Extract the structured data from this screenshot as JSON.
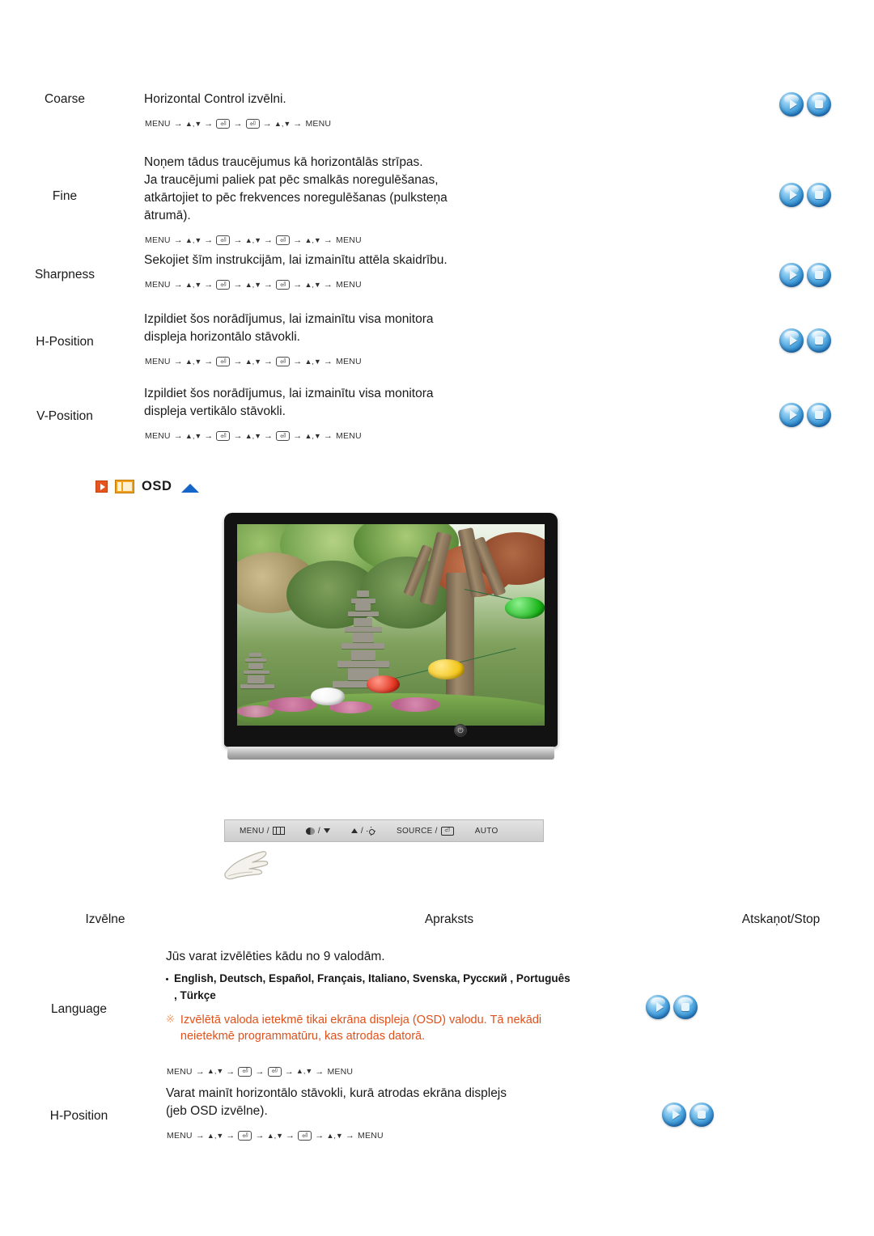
{
  "top_table": {
    "rows": [
      {
        "menu": "Coarse",
        "description": "Horizontal Control izvēlni.",
        "sequence_type": "short",
        "play_icon": "play-icon",
        "stop_icon": "stop-icon"
      },
      {
        "menu": "Fine",
        "description": "Noņem tādus traucējumus kā horizontālās strīpas.\nJa traucējumi paliek pat pēc smalkās noregulēšanas,\natkārtojiet to pēc frekvences noregulēšanas (pulksteņa\nātrumā).",
        "sequence_type": "long",
        "play_icon": "play-icon",
        "stop_icon": "stop-icon"
      },
      {
        "menu": "Sharpness",
        "description": "Sekojiet šīm instrukcijām, lai izmainītu attēla skaidrību.",
        "sequence_type": "long",
        "play_icon": "play-icon",
        "stop_icon": "stop-icon"
      },
      {
        "menu": "H-Position",
        "description": "Izpildiet šos norādījumus, lai izmainītu visa monitora\ndispleja horizontālo stāvokli.",
        "sequence_type": "long",
        "play_icon": "play-icon",
        "stop_icon": "stop-icon"
      },
      {
        "menu": "V-Position",
        "description": "Izpildiet šos norādījumus, lai izmainītu visa monitora\ndispleja vertikālo stāvokli.",
        "sequence_type": "long",
        "play_icon": "play-icon",
        "stop_icon": "stop-icon"
      }
    ]
  },
  "sequence_tokens": {
    "menu": "MENU",
    "arrow": "→",
    "up": "▲",
    "down": "▼",
    "comma": ",",
    "enter": "⏎"
  },
  "osd_section": {
    "title": "OSD",
    "play_square_icon": "play-square-icon",
    "monitor_icon": "monitor-icon",
    "collapse_icon": "up-triangle-icon"
  },
  "monitor_image": {
    "alt": "monitor displaying a garden scene with stone pagoda and paper lanterns",
    "power_glyph": "⏻"
  },
  "control_bar": {
    "items": [
      {
        "label": "MENU /",
        "glyph": "menu-grid-icon"
      },
      {
        "label": "/",
        "glyph": "contrast-down-icon"
      },
      {
        "label": "/",
        "glyph": "brightness-up-icon"
      },
      {
        "label": "SOURCE /",
        "glyph": "enter-key-icon"
      },
      {
        "label": "AUTO",
        "glyph": ""
      }
    ],
    "hand_icon": "pointing-hand-icon"
  },
  "bottom_table": {
    "headers": {
      "menu": "Izvēlne",
      "description": "Apraksts",
      "play_stop": "Atskaņot/Stop"
    },
    "rows": [
      {
        "menu": "Language",
        "intro": "Jūs varat izvēlēties kādu no 9 valodām.",
        "languages": "English, Deutsch, Español, Français,  Italiano, Svenska,\nРусский , Português , Türkçe",
        "warning_mark": "※",
        "warning": "Izvēlētā valoda ietekmē tikai ekrāna displeja (OSD) valodu. Tā nekādi neietekmē programmatūru, kas atrodas datorā.",
        "sequence_type": "short",
        "play_icon": "play-icon",
        "stop_icon": "stop-icon"
      },
      {
        "menu": "H-Position",
        "description": "Varat mainīt horizontālo stāvokli, kurā atrodas ekrāna displejs\n(jeb OSD izvēlne).",
        "sequence_type": "long",
        "play_icon": "play-icon",
        "stop_icon": "stop-icon"
      }
    ]
  },
  "colors": {
    "warning_text": "#e2501a",
    "osd_play_icon": "#e8541d",
    "osd_monitor_icon": "#f2a01c",
    "collapse_triangle": "#1665c8",
    "button_blue": "#4aa3dd"
  }
}
